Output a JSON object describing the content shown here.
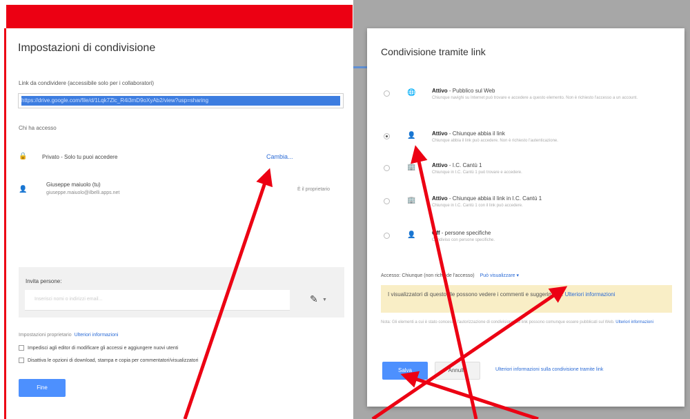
{
  "left": {
    "title": "Impostazioni di condivisione",
    "link_label": "Link da condividere (accessibile solo per i collaboratori)",
    "link_value": "https://drive.google.com/file/d/1Lqk7Zlc_R4i3mD9oXyAb2/view?usp=sharing",
    "access_label": "Chi ha accesso",
    "private_text": "Privato - Solo tu puoi accedere",
    "change_link": "Cambia...",
    "owner_name": "Giuseppe maiuolo (tu)",
    "owner_email": "giuseppe.maiuolo@ilbelli.apps.net",
    "owner_role": "È il proprietario",
    "invite_label": "Invita persone:",
    "invite_placeholder": "Inserisci nomi o indirizzi email...",
    "owner_settings": "Impostazioni proprietario",
    "owner_settings_link": "Ulteriori informazioni",
    "check1": "Impedisci agli editor di modificare gli accessi e aggiungere nuovi utenti",
    "check2": "Disattiva le opzioni di download, stampa e copia per commentatori/visualizzatori",
    "done_label": "Fine"
  },
  "right": {
    "title": "Condivisione tramite link",
    "options": [
      {
        "bold": "Attivo",
        "text": " - Pubblico sul Web",
        "desc": "Chiunque navighi su Internet può trovare e accedere a questo elemento. Non è richiesto l'accesso a un account."
      },
      {
        "bold": "Attivo",
        "text": " - Chiunque abbia il link",
        "desc": "Chiunque abbia il link può accedere. Non è richiesto l'autenticazione."
      },
      {
        "bold": "Attivo",
        "text": " - I.C. Cantù 1",
        "desc": "Chiunque in I.C. Cantù 1 può trovare e accedere."
      },
      {
        "bold": "Attivo",
        "text": " - Chiunque abbia il link in I.C. Cantù 1",
        "desc": "Chiunque in I.C. Cantù 1 con il link può accedere."
      },
      {
        "bold": "Off",
        "text": " - persone specifiche",
        "desc": "Condiviso con persone specifiche."
      }
    ],
    "access_label": "Accesso: Chiunque (non richiede l'accesso)",
    "access_permission": "Può visualizzare",
    "warning_text": "I visualizzatori di questo file possono vedere i commenti e suggerimenti.",
    "warning_link": "Ulteriori informazioni",
    "note_text": "Nota: Gli elementi a cui è stato concesso l'autorizzazione di condivisione del link possono comunque essere pubblicati sul Web.",
    "note_link": "Ulteriori informazioni",
    "save_label": "Salva",
    "cancel_label": "Annulla",
    "more_info": "Ulteriori informazioni sulla condivisione tramite link"
  },
  "colors": {
    "arrow": "#ec0013",
    "accent": "#4d90fe",
    "topbar": "#ec0013"
  }
}
